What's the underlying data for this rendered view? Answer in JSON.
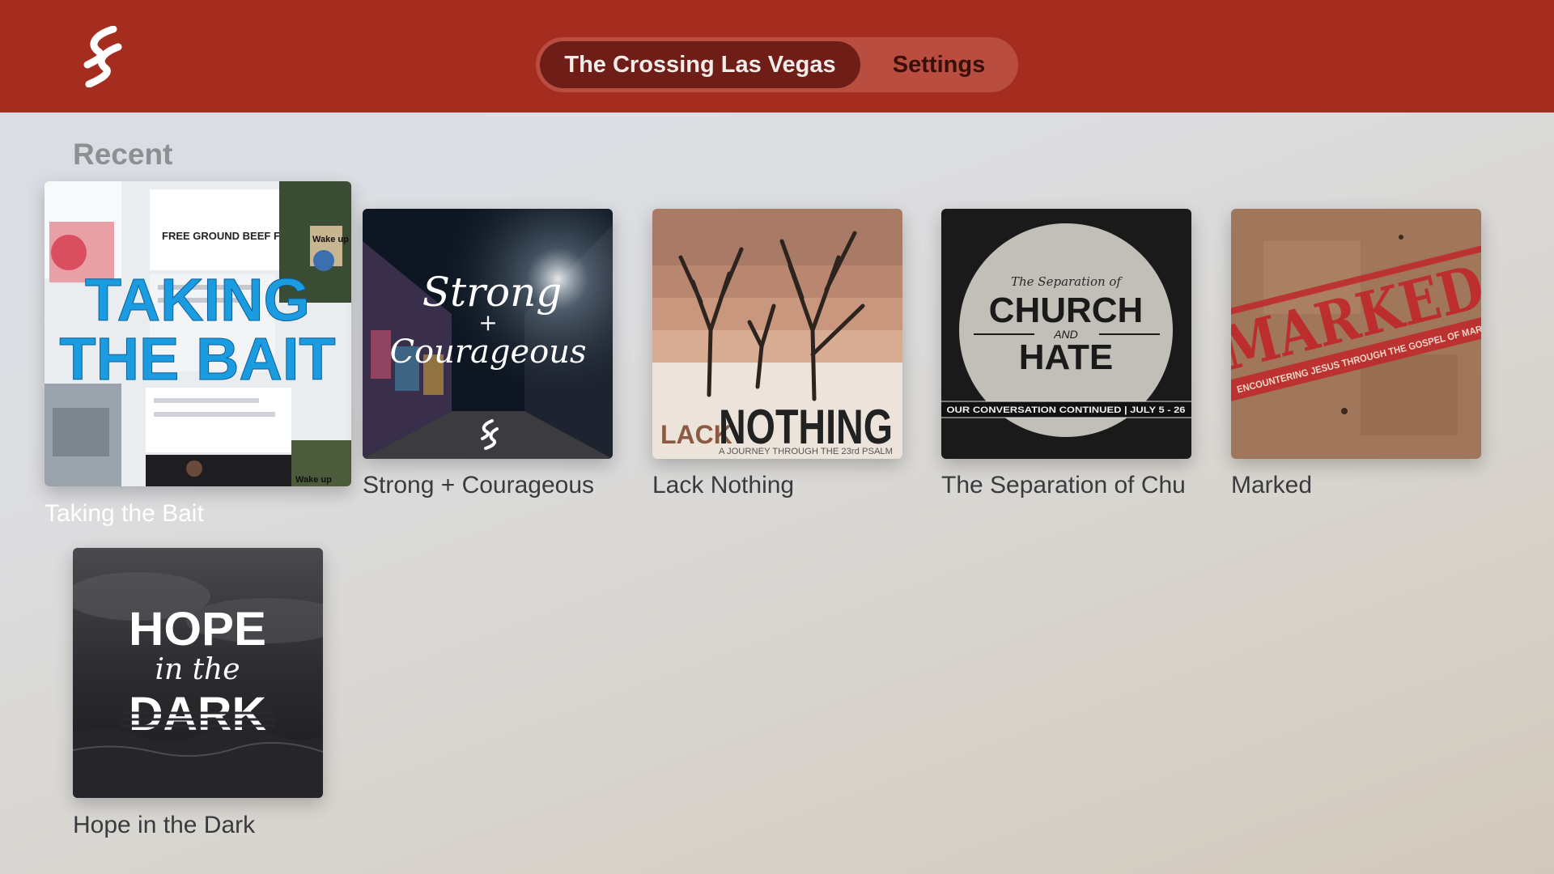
{
  "header": {
    "logo_icon": "crossing-logo-icon",
    "tabs": [
      {
        "label": "The Crossing Las Vegas",
        "active": true
      },
      {
        "label": "Settings",
        "active": false
      }
    ],
    "color": "#a42d1f"
  },
  "recent": {
    "title": "Recent",
    "items": [
      {
        "title": "Taking the Bait",
        "focused": true,
        "art": {
          "line1": "TAKING",
          "line2": "THE BAIT",
          "headline": "FREE GROUND BEEF FOR LIFE",
          "sign": "Wake up"
        }
      },
      {
        "title": "Strong + Courageous",
        "art": {
          "line1": "Strong",
          "line2": "+",
          "line3": "Courageous"
        }
      },
      {
        "title": "Lack Nothing",
        "art": {
          "line1": "LACK",
          "line2": "NOTHING",
          "subtitle": "A JOURNEY THROUGH THE 23rd PSALM"
        }
      },
      {
        "title": "The Separation of Chu",
        "art": {
          "top": "The Separation of",
          "word1": "CHURCH",
          "and": "AND",
          "word2": "HATE",
          "footer": "OUR CONVERSATION CONTINUED | JULY 5 - 26"
        }
      },
      {
        "title": "Marked",
        "art": {
          "word": "MARKED",
          "subtitle": "ENCOUNTERING JESUS THROUGH THE GOSPEL OF MARK"
        }
      },
      {
        "title": "Hope in the Dark",
        "art": {
          "line1": "HOPE",
          "line2": "in the",
          "line3": "DARK"
        }
      }
    ]
  }
}
